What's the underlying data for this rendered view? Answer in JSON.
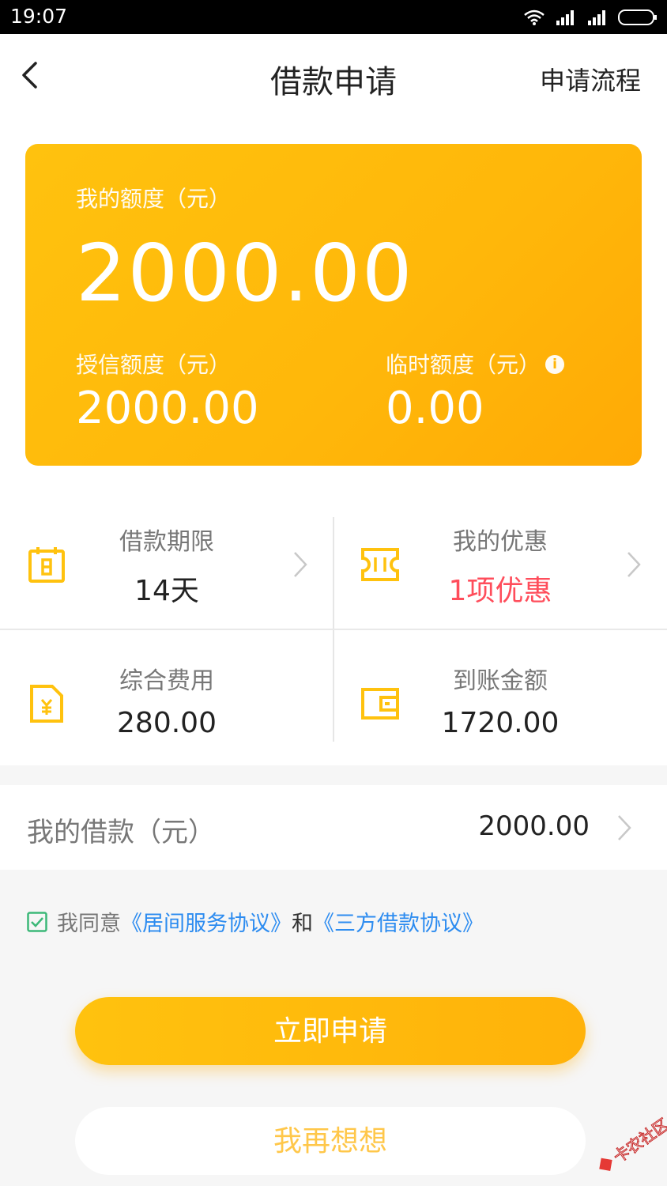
{
  "status_bar": {
    "time": "19:07"
  },
  "header": {
    "title": "借款申请",
    "process_link": "申请流程"
  },
  "card": {
    "my_limit_label": "我的额度（元）",
    "my_limit_value": "2000.00",
    "credit_limit_label": "授信额度（元）",
    "credit_limit_value": "2000.00",
    "temp_limit_label": "临时额度（元）",
    "temp_limit_value": "0.00",
    "info_symbol": "i"
  },
  "grid": {
    "term": {
      "label": "借款期限",
      "value": "14天"
    },
    "discount": {
      "label": "我的优惠",
      "value": "1项优惠"
    },
    "fee": {
      "label": "综合费用",
      "value": "280.00"
    },
    "received": {
      "label": "到账金额",
      "value": "1720.00"
    }
  },
  "loan": {
    "label": "我的借款（元）",
    "value": "2000.00"
  },
  "agreement": {
    "prefix": "我同意",
    "link1": "《居间服务协议》",
    "and": "和",
    "link2": "《三方借款协议》",
    "checked": true
  },
  "buttons": {
    "apply": "立即申请",
    "rethink": "我再想想"
  },
  "watermark": {
    "text": "卡农社区"
  },
  "colors": {
    "accent": "#ffb90b",
    "highlight_red": "#ff4d5b",
    "link_blue": "#2d8cf0",
    "icon_yellow": "#ffc20e"
  }
}
